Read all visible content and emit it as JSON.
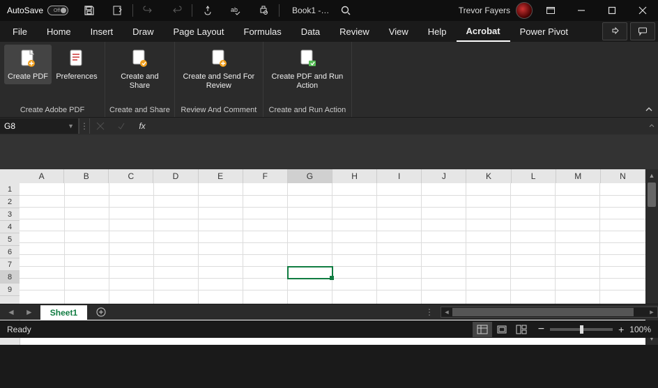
{
  "title_bar": {
    "autosave_label": "AutoSave",
    "autosave_state": "Off",
    "doc_title": "Book1 -…",
    "user_name": "Trevor Fayers"
  },
  "ribbon": {
    "tabs": [
      "File",
      "Home",
      "Insert",
      "Draw",
      "Page Layout",
      "Formulas",
      "Data",
      "Review",
      "View",
      "Help",
      "Acrobat",
      "Power Pivot"
    ],
    "active_tab": "Acrobat",
    "groups": [
      {
        "label": "Create Adobe PDF",
        "buttons": [
          {
            "label": "Create PDF",
            "selected": true
          },
          {
            "label": "Preferences",
            "selected": false
          }
        ]
      },
      {
        "label": "Create and Share",
        "buttons": [
          {
            "label": "Create and Share"
          }
        ]
      },
      {
        "label": "Review And Comment",
        "buttons": [
          {
            "label": "Create and Send For Review"
          }
        ]
      },
      {
        "label": "Create and Run Action",
        "buttons": [
          {
            "label": "Create PDF and Run Action"
          }
        ]
      }
    ]
  },
  "formula_bar": {
    "cell_ref": "G8",
    "fx_label": "fx",
    "formula": ""
  },
  "grid": {
    "columns": [
      "A",
      "B",
      "C",
      "D",
      "E",
      "F",
      "G",
      "H",
      "I",
      "J",
      "K",
      "L",
      "M",
      "N"
    ],
    "rows": [
      1,
      2,
      3,
      4,
      5,
      6,
      7,
      8,
      9
    ],
    "active_col": "G",
    "active_row": 8
  },
  "sheet_bar": {
    "active_sheet": "Sheet1"
  },
  "status_bar": {
    "status": "Ready",
    "zoom": "100%"
  }
}
